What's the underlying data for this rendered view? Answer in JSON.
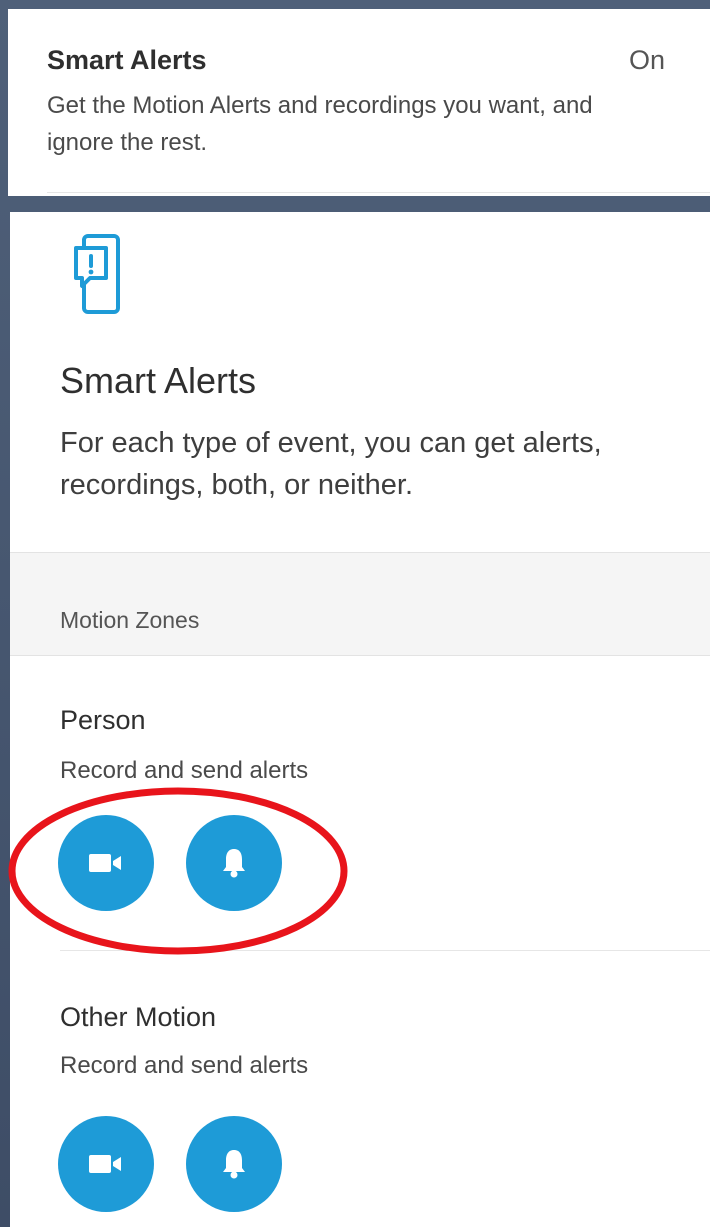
{
  "summary_card": {
    "title": "Smart Alerts",
    "status": "On",
    "description": "Get the Motion Alerts and recordings you want, and ignore the rest."
  },
  "detail": {
    "icon": "phone-alert-icon",
    "title": "Smart Alerts",
    "description": "For each type of event, you can get alerts, recordings, both, or neither.",
    "section_label": "Motion Zones",
    "items": [
      {
        "title": "Person",
        "subtitle": "Record and send alerts",
        "record_icon": "video-camera-icon",
        "alert_icon": "bell-icon"
      },
      {
        "title": "Other Motion",
        "subtitle": "Record and send alerts",
        "record_icon": "video-camera-icon",
        "alert_icon": "bell-icon"
      }
    ]
  },
  "colors": {
    "accent": "#1e9bd7",
    "annotation": "#e8141b",
    "background": "#4a5b74"
  }
}
